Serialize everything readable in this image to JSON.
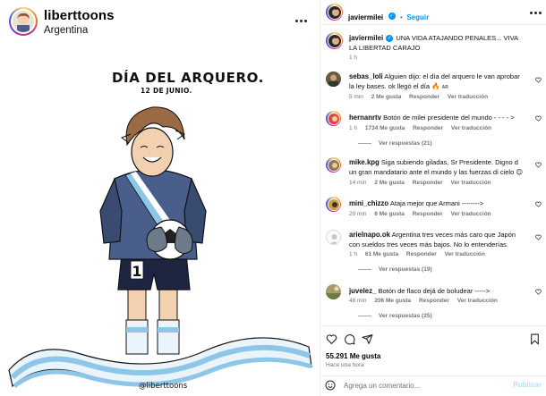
{
  "post": {
    "author": "liberttoons",
    "location": "Argentina",
    "artwork": {
      "title": "DÍA DEL ARQUERO.",
      "date": "12 DE JUNIO.",
      "signature": "@liberttoons",
      "jersey_number": "1"
    }
  },
  "panel": {
    "header": {
      "username": "javiermilei",
      "follow_label": "Seguir"
    },
    "caption": {
      "username": "javiermilei",
      "text": "UNA VIDA ATAJANDO PENALES... VIVA LA LIBERTAD CARAJO",
      "time": "1 h"
    },
    "comments": [
      {
        "user": "sebas_loli",
        "text": "Alguien dijo: el día del arquero le van aprobar la ley bases. ok llegó el día",
        "emoji": "🔥",
        "flag": "AR",
        "time": "5 min",
        "likes": "2 Me gusta",
        "reply": "Responder",
        "translate": "Ver traducción",
        "replies": ""
      },
      {
        "user": "hernanrtv",
        "text": "Botón de milei presidente del mundo - - - - >",
        "time": "1 h",
        "likes": "1734 Me gusta",
        "reply": "Responder",
        "translate": "Ver traducción",
        "replies": "Ver respuestas (21)"
      },
      {
        "user": "mike.kpg",
        "text": "Siga subiendo giladas, Sr Presidente. Digno d un gran mandatario ante el mundo y las fuerzas di cielo",
        "emoji": "😊",
        "time": "14 min",
        "likes": "2 Me gusta",
        "reply": "Responder",
        "translate": "Ver traducción",
        "replies": ""
      },
      {
        "user": "mini_chizzo",
        "text": "Ataja mejor que Armani -------->",
        "time": "20 min",
        "likes": "6 Me gusta",
        "reply": "Responder",
        "translate": "Ver traducción",
        "replies": ""
      },
      {
        "user": "arielnapo.ok",
        "text": "Argentina tres veces más caro que Japón con sueldos tres veces más bajos. No lo entenderías.",
        "time": "1 h",
        "likes": "61 Me gusta",
        "reply": "Responder",
        "translate": "Ver traducción",
        "replies": "Ver respuestas (19)"
      },
      {
        "user": "juvelez_",
        "text": "Botón de flaco dejá de boludear ----->",
        "time": "48 min",
        "likes": "206 Me gusta",
        "reply": "Responder",
        "translate": "Ver traducción",
        "replies": "Ver respuestas (25)"
      }
    ],
    "likes_count": "55.291 Me gusta",
    "posted_time": "Hace una hora",
    "add_comment": {
      "placeholder": "Agrega un comentario...",
      "publish_label": "Publicar"
    }
  },
  "colors": {
    "accent": "#0095f6",
    "muted": "#737373",
    "sky_blue": "#8ec6ea",
    "jersey": "#4a5e8c"
  }
}
